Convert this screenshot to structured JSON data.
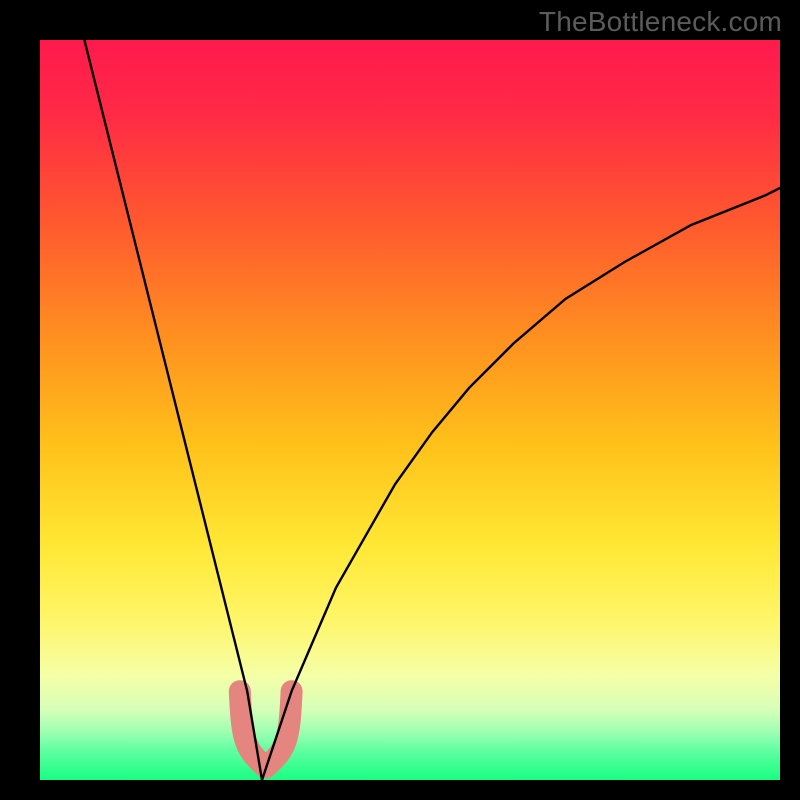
{
  "watermark": "TheBottleneck.com",
  "colors": {
    "top": "#ff1a4d",
    "mid_upper": "#ff6a2a",
    "mid": "#ffd21f",
    "mid_lower": "#ffef66",
    "pale": "#f6ffb0",
    "green_light": "#8dffad",
    "green": "#16ff7e",
    "curve": "#000000",
    "blob": "#e4867f",
    "frame": "#000000"
  },
  "gradient_stops": [
    {
      "offset": 0.0,
      "color": "#ff1a4d"
    },
    {
      "offset": 0.1,
      "color": "#ff2a45"
    },
    {
      "offset": 0.25,
      "color": "#ff5a2e"
    },
    {
      "offset": 0.4,
      "color": "#ff8f20"
    },
    {
      "offset": 0.55,
      "color": "#ffc21a"
    },
    {
      "offset": 0.68,
      "color": "#ffe733"
    },
    {
      "offset": 0.78,
      "color": "#fff566"
    },
    {
      "offset": 0.86,
      "color": "#f5ffa8"
    },
    {
      "offset": 0.905,
      "color": "#d6ffb8"
    },
    {
      "offset": 0.935,
      "color": "#9dffb3"
    },
    {
      "offset": 0.962,
      "color": "#5cffa0"
    },
    {
      "offset": 1.0,
      "color": "#18ff82"
    }
  ],
  "chart_data": {
    "type": "line",
    "title": "",
    "xlabel": "",
    "ylabel": "",
    "xlim": [
      0,
      100
    ],
    "ylim": [
      0,
      100
    ],
    "notch_x": 30,
    "series": [
      {
        "name": "left-branch",
        "x": [
          6,
          8,
          10,
          12,
          14,
          16,
          18,
          20,
          22,
          24,
          26,
          28,
          29,
          30
        ],
        "y": [
          100,
          92,
          84,
          76,
          68,
          60,
          52,
          44,
          36,
          28,
          20,
          12,
          6,
          0
        ]
      },
      {
        "name": "right-branch",
        "x": [
          30,
          32,
          34,
          37,
          40,
          44,
          48,
          53,
          58,
          64,
          71,
          79,
          88,
          98,
          100
        ],
        "y": [
          0,
          6,
          12,
          19,
          26,
          33,
          40,
          47,
          53,
          59,
          65,
          70,
          75,
          79,
          80
        ]
      }
    ],
    "highlight_region": {
      "name": "salmon-blob",
      "description": "rounded U-shaped marker at the curve minimum",
      "approx_x_range": [
        27,
        34
      ],
      "approx_y_range": [
        0,
        12
      ]
    }
  }
}
